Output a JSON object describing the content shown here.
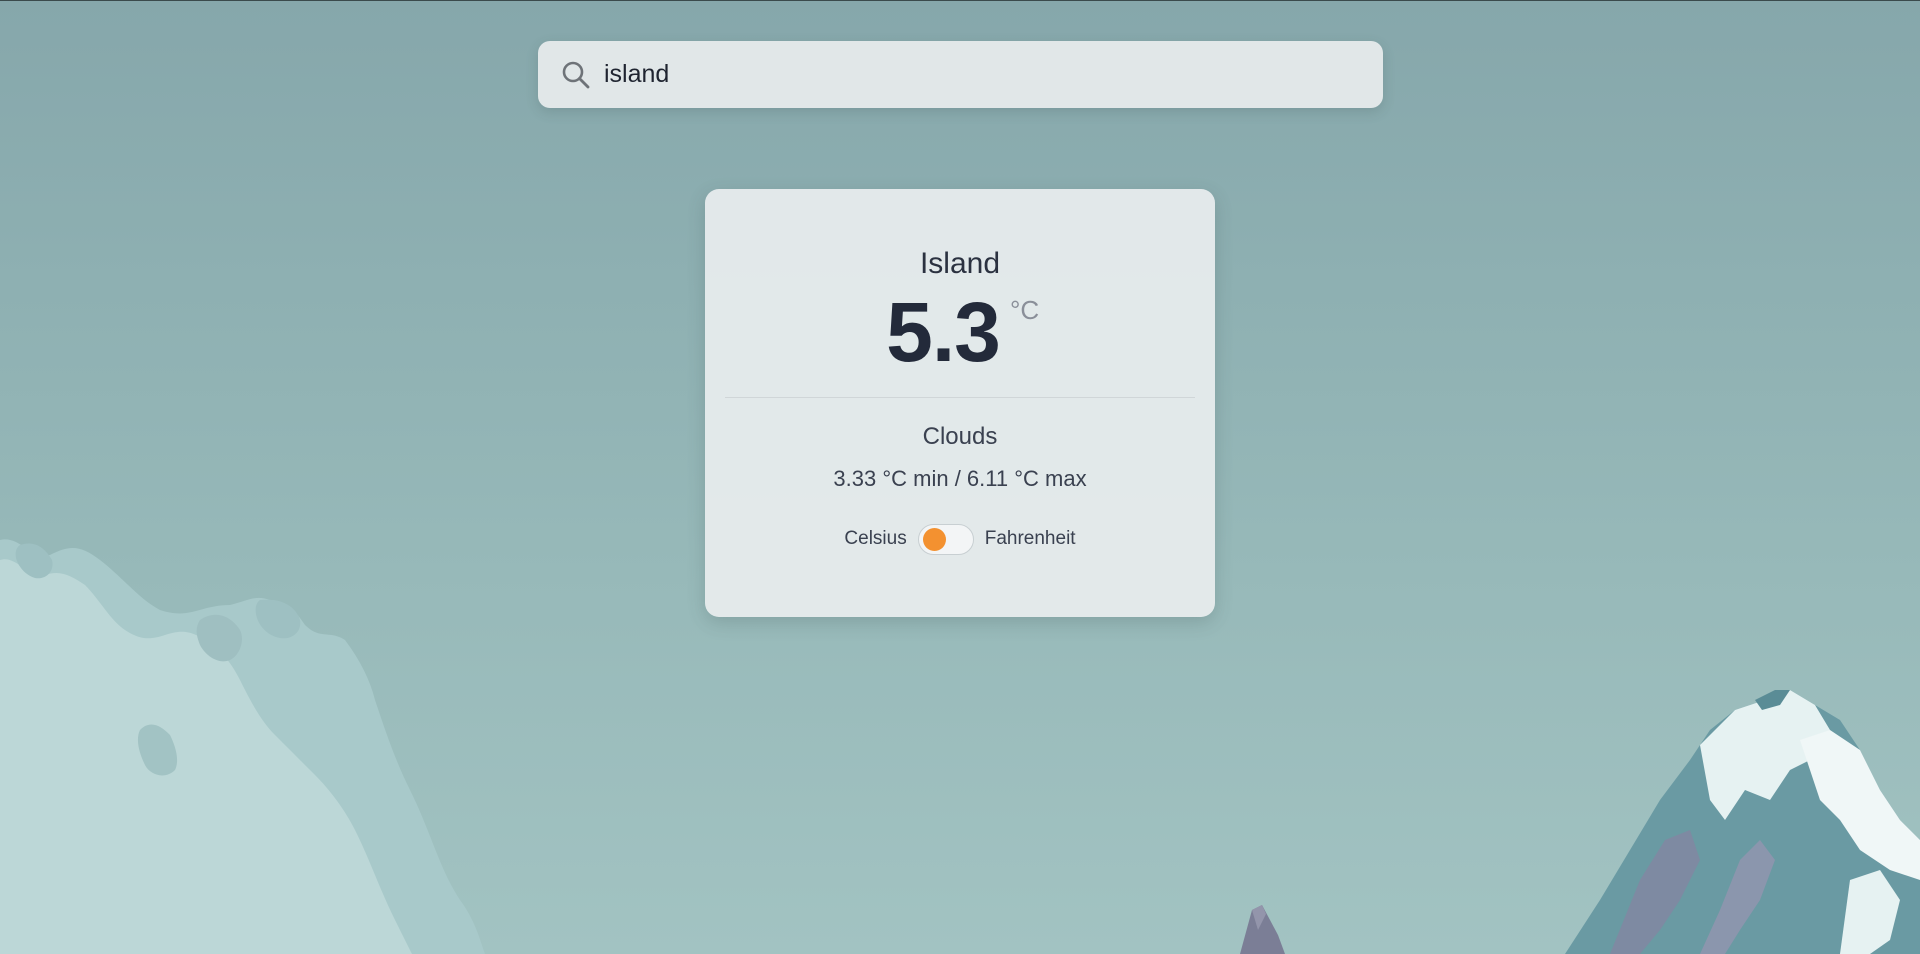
{
  "search": {
    "value": "island",
    "icon": "search-icon"
  },
  "weather": {
    "city": "Island",
    "temperature": "5.3",
    "unit": "°C",
    "condition": "Clouds",
    "minmax": "3.33 °C min / 6.11 °C max"
  },
  "unit_toggle": {
    "left_label": "Celsius",
    "right_label": "Fahrenheit",
    "selected": "Celsius",
    "knob_color": "#f39130"
  },
  "colors": {
    "background": "#8eb0b2",
    "card": "#e8edee",
    "text_dark": "#232a3a",
    "accent": "#f39130"
  }
}
